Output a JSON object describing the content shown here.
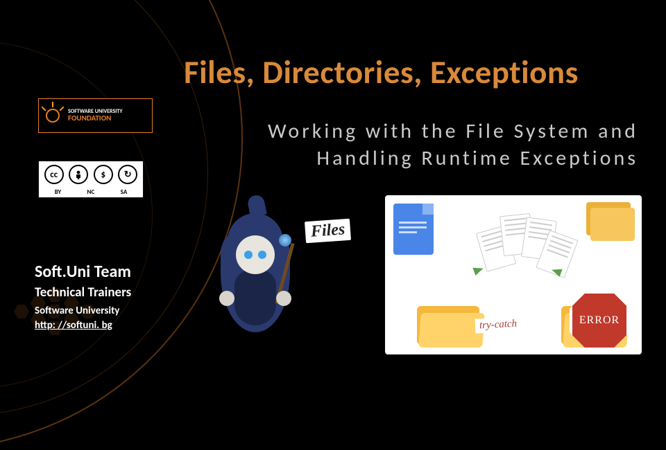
{
  "title": "Files, Directories, Exceptions",
  "subtitle": "Working with the File System and Handling Runtime Exceptions",
  "logo": {
    "line1": "SOFTWARE UNIVERSITY",
    "line2": "FOUNDATION"
  },
  "cc": {
    "symbol": "cc",
    "labels": [
      "BY",
      "NC",
      "SA"
    ]
  },
  "team": {
    "line1": "Soft.Uni Team",
    "line2": "Technical Trainers",
    "line3": "Software University",
    "link": "http: //softuni. bg"
  },
  "labels": {
    "files": "Files",
    "try_catch": "try-catch",
    "error": "ERROR"
  }
}
